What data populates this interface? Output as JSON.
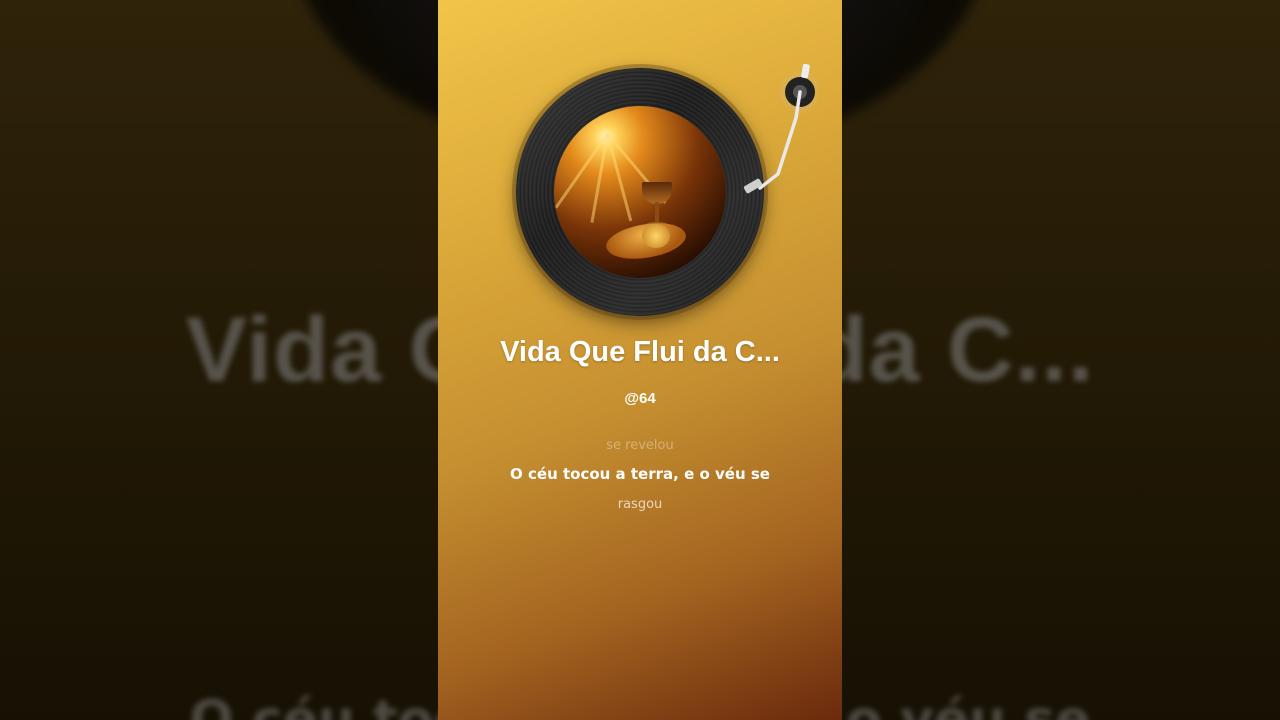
{
  "song": {
    "title": "Vida Que Flui da C...",
    "artist": "@64"
  },
  "lyrics": {
    "previous": "se revelou",
    "current": "O céu tocou a terra, e o véu se",
    "next": "rasgou"
  },
  "background": {
    "title_echo": "Vida Que Flui da C...",
    "lyric_echo": "O céu tocou a terra, e o véu se"
  },
  "colors": {
    "card_top": "#f1c549",
    "card_bottom": "#6b2a0c",
    "text": "#ffffff"
  },
  "icons": {
    "vinyl": "vinyl-record-icon",
    "tonearm": "tonearm-icon"
  }
}
